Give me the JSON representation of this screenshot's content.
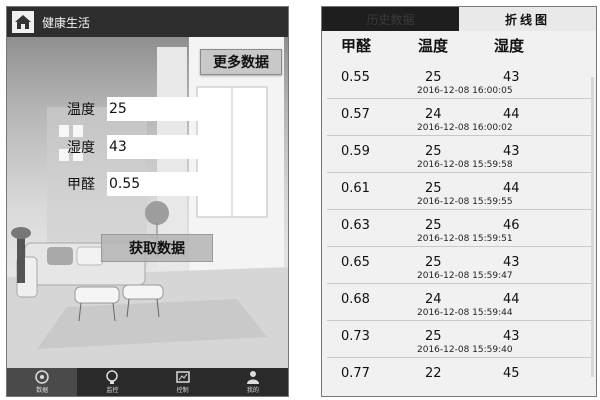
{
  "left_phone": {
    "title": "健康生活",
    "more_button": "更多数据",
    "fields": [
      {
        "label": "温度",
        "value": "25"
      },
      {
        "label": "湿度",
        "value": "43"
      },
      {
        "label": "甲醛",
        "value": "0.55"
      }
    ],
    "fetch_button": "获取数据",
    "nav": [
      {
        "label": "数据",
        "icon": "data-icon"
      },
      {
        "label": "监控",
        "icon": "monitor-icon"
      },
      {
        "label": "控制",
        "icon": "control-icon"
      },
      {
        "label": "我的",
        "icon": "user-icon"
      }
    ]
  },
  "right_phone": {
    "tabs": [
      "历史数据",
      "折线图"
    ],
    "headers": [
      "甲醛",
      "温度",
      "湿度"
    ],
    "rows": [
      {
        "formaldehyde": "0.55",
        "temperature": "25",
        "humidity": "43",
        "time": "2016-12-08 16:00:05"
      },
      {
        "formaldehyde": "0.57",
        "temperature": "24",
        "humidity": "44",
        "time": "2016-12-08 16:00:02"
      },
      {
        "formaldehyde": "0.59",
        "temperature": "25",
        "humidity": "43",
        "time": "2016-12-08 15:59:58"
      },
      {
        "formaldehyde": "0.61",
        "temperature": "25",
        "humidity": "44",
        "time": "2016-12-08 15:59:55"
      },
      {
        "formaldehyde": "0.63",
        "temperature": "25",
        "humidity": "46",
        "time": "2016-12-08 15:59:51"
      },
      {
        "formaldehyde": "0.65",
        "temperature": "25",
        "humidity": "43",
        "time": "2016-12-08 15:59:47"
      },
      {
        "formaldehyde": "0.68",
        "temperature": "24",
        "humidity": "44",
        "time": "2016-12-08 15:59:44"
      },
      {
        "formaldehyde": "0.73",
        "temperature": "25",
        "humidity": "43",
        "time": "2016-12-08 15:59:40"
      },
      {
        "formaldehyde": "0.77",
        "temperature": "22",
        "humidity": "45",
        "time": ""
      }
    ]
  }
}
